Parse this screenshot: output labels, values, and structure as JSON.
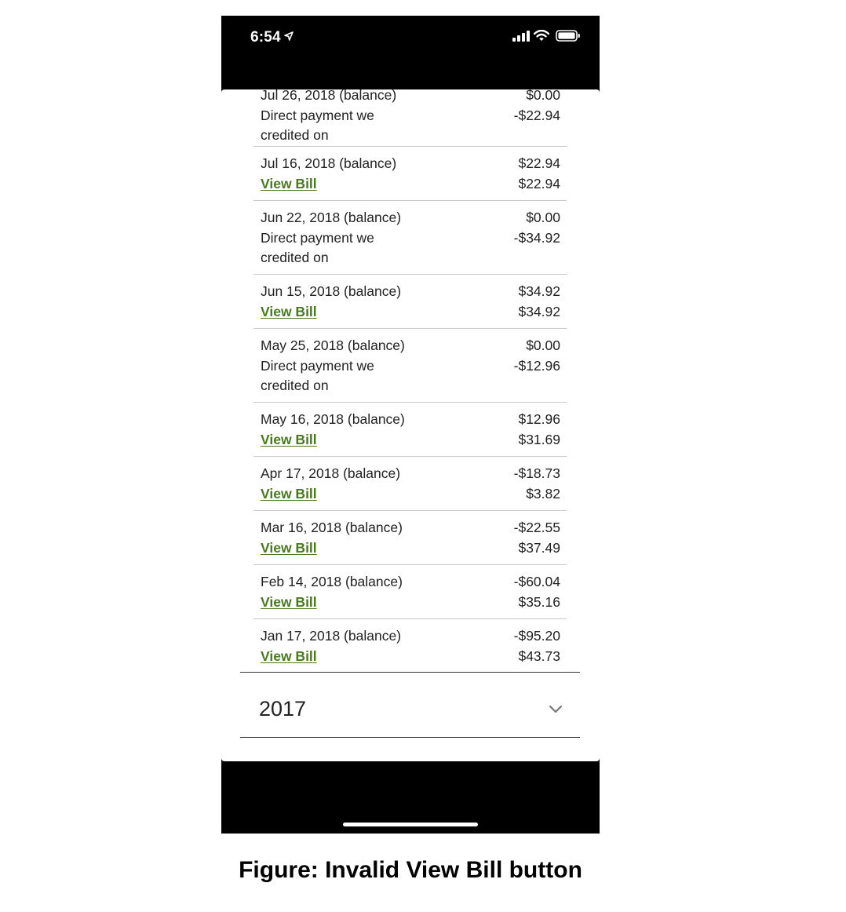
{
  "status_bar": {
    "time": "6:54"
  },
  "transactions": [
    {
      "left": [
        "Jul 26, 2018 (balance)",
        "Direct payment we",
        "credited on"
      ],
      "right": [
        "$0.00",
        "-$22.94"
      ]
    },
    {
      "date": "Jul 16, 2018 (balance)",
      "link": "View Bill",
      "right": [
        "$22.94",
        "$22.94"
      ]
    },
    {
      "left": [
        "Jun 22, 2018 (balance)",
        "Direct payment we",
        "credited on"
      ],
      "right": [
        "$0.00",
        "-$34.92"
      ]
    },
    {
      "date": "Jun 15, 2018 (balance)",
      "link": "View Bill",
      "right": [
        "$34.92",
        "$34.92"
      ]
    },
    {
      "left": [
        "May 25, 2018 (balance)",
        "Direct payment we",
        "credited on"
      ],
      "right": [
        "$0.00",
        "-$12.96"
      ]
    },
    {
      "date": "May 16, 2018 (balance)",
      "link": "View Bill",
      "right": [
        "$12.96",
        "$31.69"
      ]
    },
    {
      "date": "Apr 17, 2018 (balance)",
      "link": "View Bill",
      "right": [
        "-$18.73",
        "$3.82"
      ]
    },
    {
      "date": "Mar 16, 2018 (balance)",
      "link": "View Bill",
      "right": [
        "-$22.55",
        "$37.49"
      ]
    },
    {
      "date": "Feb 14, 2018 (balance)",
      "link": "View Bill",
      "right": [
        "-$60.04",
        "$35.16"
      ]
    },
    {
      "date": "Jan 17, 2018 (balance)",
      "link": "View Bill",
      "right": [
        "-$95.20",
        "$43.73"
      ]
    }
  ],
  "year_section": {
    "label": "2017"
  },
  "caption": "Figure: Invalid View Bill button",
  "colors": {
    "link": "#4a7a20",
    "frame": "#000000",
    "divider": "#c9c9c9"
  },
  "icons": [
    "location-arrow-icon",
    "signal-icon",
    "wifi-icon",
    "battery-icon",
    "chevron-down-icon"
  ]
}
